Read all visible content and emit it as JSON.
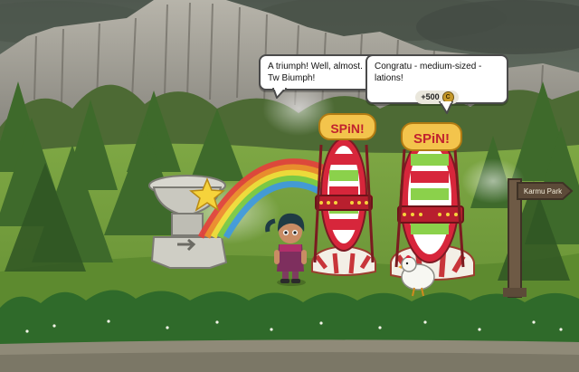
{
  "dialogs": [
    {
      "text": "A triumph! Well, almost. Tw Biumph!"
    },
    {
      "text": "Congratu - medium-sized - lations!",
      "reward": {
        "amount": "+500",
        "icon": "coin-icon"
      }
    }
  ],
  "wheels": [
    {
      "sign": "SPiN!"
    },
    {
      "sign": "SPiN!"
    }
  ],
  "location_sign": {
    "text": "Karmu Park"
  },
  "colors": {
    "sky": "#5b665c",
    "grass": "#6f9a3a",
    "wheel_red": "#d7263b",
    "wheel_green": "#8bd14b",
    "sign_gold": "#f3c44c"
  }
}
